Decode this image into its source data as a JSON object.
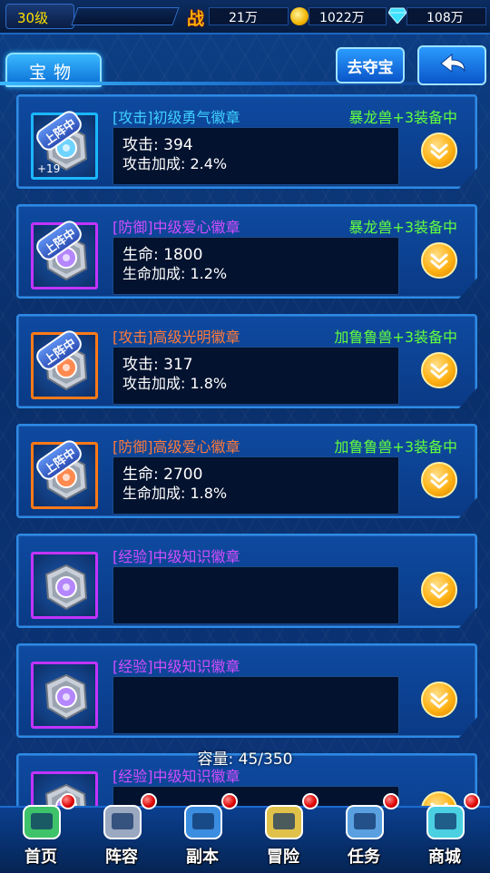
{
  "topbar": {
    "level": "30级",
    "power_label": "战",
    "power_value": "21万",
    "gold_value": "1022万",
    "gems_value": "108万"
  },
  "tab": {
    "label": "宝物"
  },
  "buttons": {
    "loot_label": "去夺宝"
  },
  "colors": {
    "attack_name": "#3fd0ff",
    "defense_name": "#d24dff",
    "exp_name": "#d24dff",
    "orange_name": "#ff7a3a",
    "owner": "#63ff3e"
  },
  "items": [
    {
      "name": "[攻击]初级勇气徽章",
      "owner": "暴龙兽+3装备中",
      "line1": "攻击: 394",
      "line2": "攻击加成: 2.4%",
      "equipped": "上阵中",
      "plus": "+19",
      "frame": "blue",
      "icon": "gear-badge-blue-icon"
    },
    {
      "name": "[防御]中级爱心徽章",
      "owner": "暴龙兽+3装备中",
      "line1": "生命: 1800",
      "line2": "生命加成: 1.2%",
      "equipped": "上阵中",
      "plus": "",
      "frame": "purple",
      "icon": "heart-badge-purple-icon"
    },
    {
      "name": "[攻击]高级光明徽章",
      "owner": "加鲁鲁兽+3装备中",
      "line1": "攻击: 317",
      "line2": "攻击加成: 1.8%",
      "equipped": "上阵中",
      "plus": "",
      "frame": "orange",
      "icon": "sun-badge-orange-icon"
    },
    {
      "name": "[防御]高级爱心徽章",
      "owner": "加鲁鲁兽+3装备中",
      "line1": "生命: 2700",
      "line2": "生命加成: 1.8%",
      "equipped": "上阵中",
      "plus": "",
      "frame": "orange",
      "icon": "heart-badge-orange-icon"
    },
    {
      "name": "[经验]中级知识徽章",
      "owner": "",
      "line1": "",
      "line2": "",
      "equipped": "",
      "plus": "",
      "frame": "purple",
      "icon": "knowledge-badge-purple-icon"
    },
    {
      "name": "[经验]中级知识徽章",
      "owner": "",
      "line1": "",
      "line2": "",
      "equipped": "",
      "plus": "",
      "frame": "purple",
      "icon": "knowledge-badge-purple-icon"
    },
    {
      "name": "[经验]中级知识徽章",
      "owner": "",
      "line1": "",
      "line2": "",
      "equipped": "",
      "plus": "",
      "frame": "purple",
      "icon": "knowledge-badge-purple-icon"
    }
  ],
  "capacity": "容量: 45/350",
  "nav": [
    {
      "label": "首页",
      "icon": "home-device-icon"
    },
    {
      "label": "阵容",
      "icon": "team-gear-icon"
    },
    {
      "label": "副本",
      "icon": "scroll-map-icon"
    },
    {
      "label": "冒险",
      "icon": "adventure-map-icon"
    },
    {
      "label": "任务",
      "icon": "laptop-icon"
    },
    {
      "label": "商城",
      "icon": "shopping-cart-icon"
    }
  ]
}
